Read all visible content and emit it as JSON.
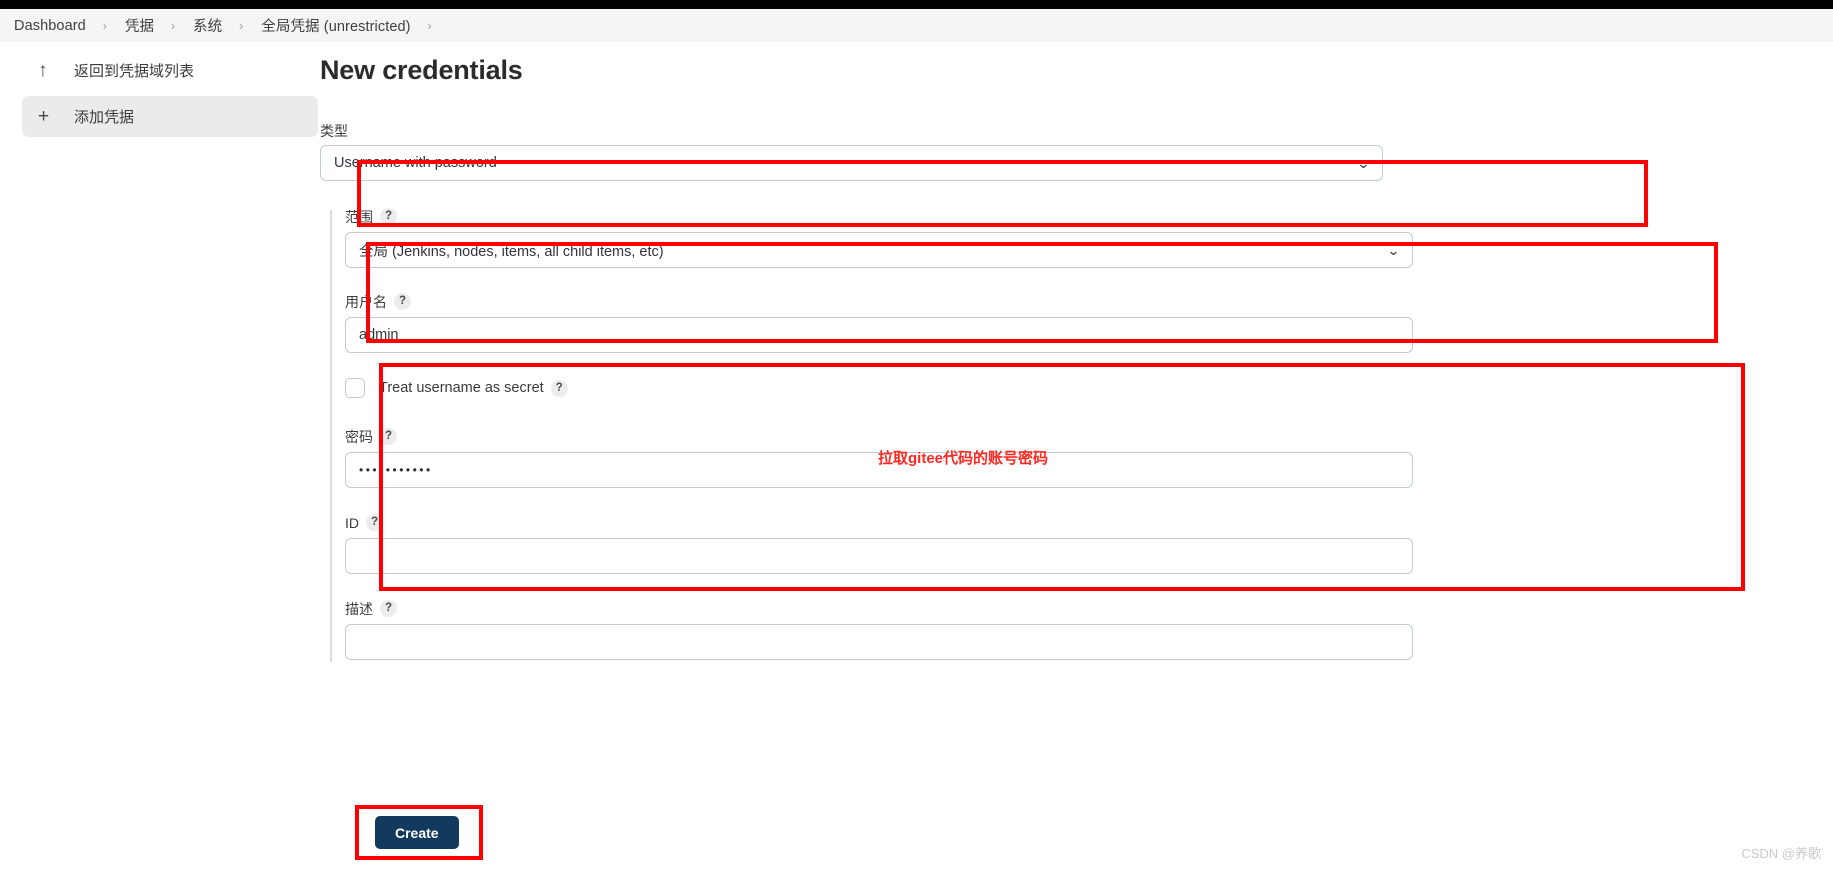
{
  "breadcrumb": {
    "items": [
      "Dashboard",
      "凭据",
      "系统",
      "全局凭据 (unrestricted)"
    ],
    "separator": "›"
  },
  "sidebar": {
    "items": [
      {
        "label": "返回到凭据域列表",
        "icon": "arrow-up-icon",
        "glyph": "↑",
        "active": false
      },
      {
        "label": "添加凭据",
        "icon": "plus-icon",
        "glyph": "+",
        "active": true
      }
    ]
  },
  "main": {
    "title": "New credentials",
    "fields": {
      "kind": {
        "label": "类型",
        "value": "Username with password",
        "chevron": "⌄"
      },
      "scope": {
        "label": "范围",
        "help": "?",
        "value": "全局 (Jenkins, nodes, items, all child items, etc)",
        "chevron": "⌄"
      },
      "username": {
        "label": "用户名",
        "help": "?",
        "value": "admin"
      },
      "treat_secret": {
        "label": "Treat username as secret",
        "help": "?",
        "checked": false
      },
      "password": {
        "label": "密码",
        "help": "?",
        "value": "•••••••••••"
      },
      "id": {
        "label": "ID",
        "help": "?",
        "value": ""
      },
      "description": {
        "label": "描述",
        "help": "?",
        "value": ""
      }
    },
    "submit": {
      "label": "Create"
    }
  },
  "annotations": {
    "note": "拉取gitee代码的账号密码",
    "color": "#ff0000"
  },
  "watermark": "CSDN @养歌"
}
